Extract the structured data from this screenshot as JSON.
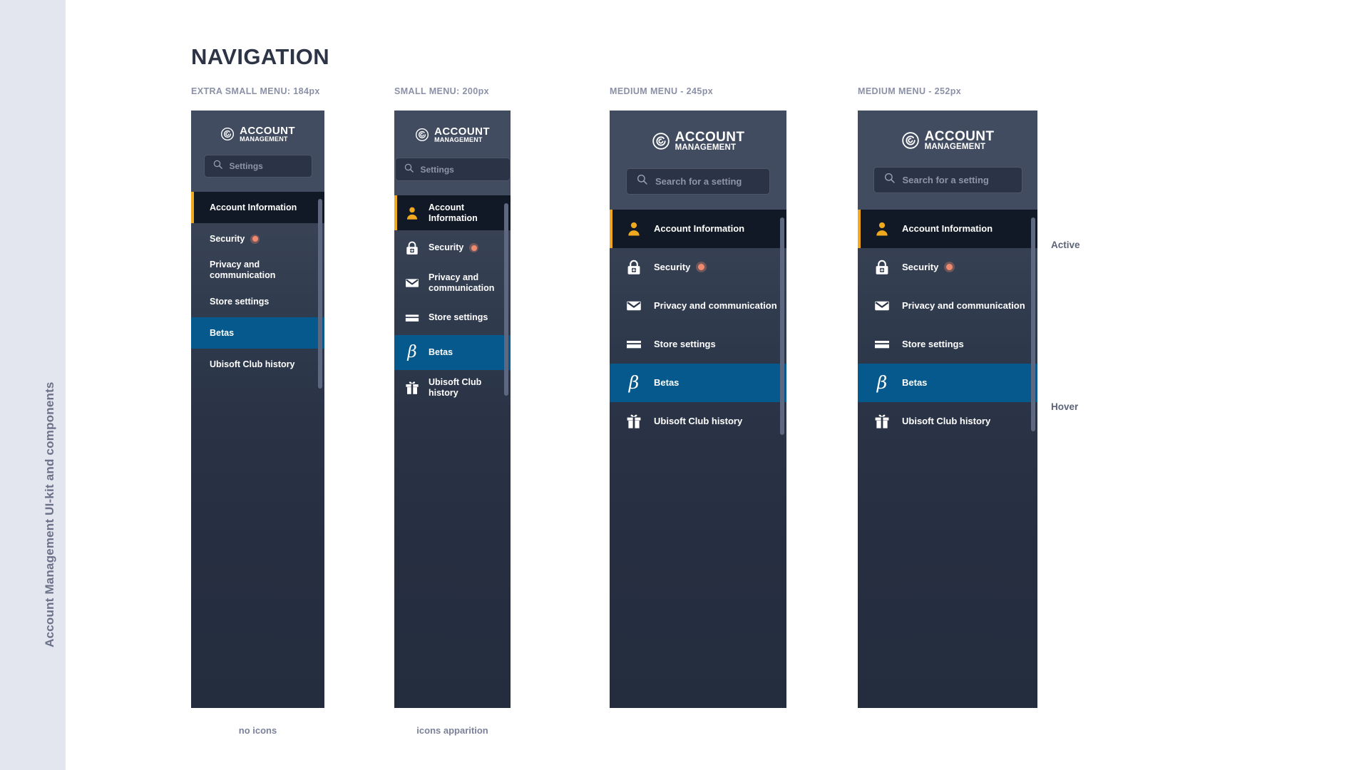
{
  "rail": {
    "label": "Account Management UI-kit and components"
  },
  "page": {
    "title": "NAVIGATION"
  },
  "brand": {
    "line1": "ACCOUNT",
    "line2": "MANAGEMENT",
    "logo_icon": "ubisoft-spiral-logo-icon"
  },
  "colors": {
    "panel_header": "#424c60",
    "panel_body_top": "#3e485c",
    "panel_body_bottom": "#242d3e",
    "active_bg": "#121926",
    "active_accent": "#f0a91e",
    "hover_bg": "#05598c",
    "badge_dot": "#f08a6e",
    "rail_bg": "#e3e5ef",
    "heading": "#2d3446",
    "label_muted": "#8a90a6"
  },
  "annotations": {
    "active": "Active",
    "hover": "Hover"
  },
  "panels": [
    {
      "id": "extra-small",
      "label": "EXTRA SMALL MENU: 184px",
      "caption": "no icons",
      "search_placeholder": "Settings",
      "show_icons": false,
      "items": [
        {
          "label": "Account Information",
          "icon": "person-icon",
          "state": "active",
          "badge": false
        },
        {
          "label": "Security",
          "icon": "lock-gear-icon",
          "state": "default",
          "badge": true
        },
        {
          "label": "Privacy and communication",
          "icon": "envelope-icon",
          "state": "default",
          "badge": false
        },
        {
          "label": "Store settings",
          "icon": "credit-card-icon",
          "state": "default",
          "badge": false
        },
        {
          "label": "Betas",
          "icon": "beta-icon",
          "state": "hover",
          "badge": false
        },
        {
          "label": "Ubisoft Club history",
          "icon": "gift-icon",
          "state": "default",
          "badge": false
        }
      ]
    },
    {
      "id": "small",
      "label": "SMALL MENU: 200px",
      "caption": "icons apparition",
      "search_placeholder": "Settings",
      "show_icons": true,
      "items": [
        {
          "label": "Account Information",
          "icon": "person-icon",
          "state": "active",
          "badge": false
        },
        {
          "label": "Security",
          "icon": "lock-gear-icon",
          "state": "default",
          "badge": true
        },
        {
          "label": "Privacy and communication",
          "icon": "envelope-icon",
          "state": "default",
          "badge": false
        },
        {
          "label": "Store settings",
          "icon": "credit-card-icon",
          "state": "default",
          "badge": false
        },
        {
          "label": "Betas",
          "icon": "beta-icon",
          "state": "hover",
          "badge": false
        },
        {
          "label": "Ubisoft Club history",
          "icon": "gift-icon",
          "state": "default",
          "badge": false
        }
      ]
    },
    {
      "id": "medium-245",
      "label": "MEDIUM MENU - 245px",
      "caption": "",
      "search_placeholder": "Search for a setting",
      "show_icons": true,
      "items": [
        {
          "label": "Account Information",
          "icon": "person-icon",
          "state": "active",
          "badge": false
        },
        {
          "label": "Security",
          "icon": "lock-gear-icon",
          "state": "default",
          "badge": true
        },
        {
          "label": "Privacy and communication",
          "icon": "envelope-icon",
          "state": "default",
          "badge": false
        },
        {
          "label": "Store settings",
          "icon": "credit-card-icon",
          "state": "default",
          "badge": false
        },
        {
          "label": "Betas",
          "icon": "beta-icon",
          "state": "hover",
          "badge": false
        },
        {
          "label": "Ubisoft Club history",
          "icon": "gift-icon",
          "state": "default",
          "badge": false
        }
      ]
    },
    {
      "id": "medium-252",
      "label": "MEDIUM MENU - 252px",
      "caption": "",
      "search_placeholder": "Search for a setting",
      "show_icons": true,
      "items": [
        {
          "label": "Account Information",
          "icon": "person-icon",
          "state": "active",
          "badge": false
        },
        {
          "label": "Security",
          "icon": "lock-gear-icon",
          "state": "default",
          "badge": true
        },
        {
          "label": "Privacy and communication",
          "icon": "envelope-icon",
          "state": "default",
          "badge": false
        },
        {
          "label": "Store settings",
          "icon": "credit-card-icon",
          "state": "default",
          "badge": false
        },
        {
          "label": "Betas",
          "icon": "beta-icon",
          "state": "hover",
          "badge": false
        },
        {
          "label": "Ubisoft Club history",
          "icon": "gift-icon",
          "state": "default",
          "badge": false
        }
      ]
    }
  ]
}
